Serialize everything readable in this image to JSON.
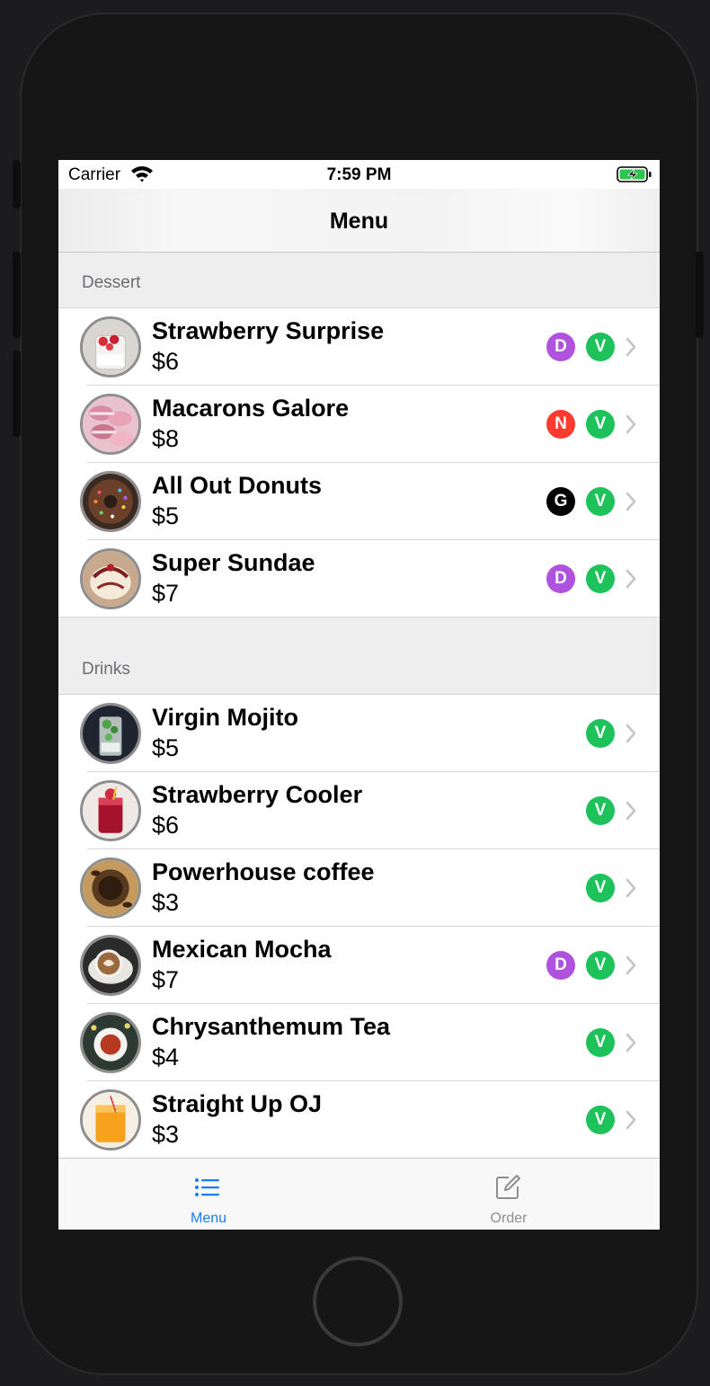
{
  "status_bar": {
    "carrier": "Carrier",
    "time": "7:59 PM"
  },
  "nav": {
    "title": "Menu"
  },
  "sections": [
    {
      "title": "Dessert",
      "items": [
        {
          "name": "Strawberry Surprise",
          "price": "$6",
          "badges": [
            {
              "letter": "D",
              "color": "#af52de"
            },
            {
              "letter": "V",
              "color": "#1ec25a"
            }
          ],
          "image": "strawberry-dessert"
        },
        {
          "name": "Macarons Galore",
          "price": "$8",
          "badges": [
            {
              "letter": "N",
              "color": "#ff3b30"
            },
            {
              "letter": "V",
              "color": "#1ec25a"
            }
          ],
          "image": "macarons"
        },
        {
          "name": "All Out Donuts",
          "price": "$5",
          "badges": [
            {
              "letter": "G",
              "color": "#000000"
            },
            {
              "letter": "V",
              "color": "#1ec25a"
            }
          ],
          "image": "donuts"
        },
        {
          "name": "Super Sundae",
          "price": "$7",
          "badges": [
            {
              "letter": "D",
              "color": "#af52de"
            },
            {
              "letter": "V",
              "color": "#1ec25a"
            }
          ],
          "image": "sundae"
        }
      ]
    },
    {
      "title": "Drinks",
      "items": [
        {
          "name": "Virgin Mojito",
          "price": "$5",
          "badges": [
            {
              "letter": "V",
              "color": "#1ec25a"
            }
          ],
          "image": "mojito"
        },
        {
          "name": "Strawberry Cooler",
          "price": "$6",
          "badges": [
            {
              "letter": "V",
              "color": "#1ec25a"
            }
          ],
          "image": "strawberry-cooler"
        },
        {
          "name": "Powerhouse coffee",
          "price": "$3",
          "badges": [
            {
              "letter": "V",
              "color": "#1ec25a"
            }
          ],
          "image": "coffee-beans"
        },
        {
          "name": "Mexican Mocha",
          "price": "$7",
          "badges": [
            {
              "letter": "D",
              "color": "#af52de"
            },
            {
              "letter": "V",
              "color": "#1ec25a"
            }
          ],
          "image": "mocha"
        },
        {
          "name": "Chrysanthemum Tea",
          "price": "$4",
          "badges": [
            {
              "letter": "V",
              "color": "#1ec25a"
            }
          ],
          "image": "tea"
        },
        {
          "name": "Straight Up OJ",
          "price": "$3",
          "badges": [
            {
              "letter": "V",
              "color": "#1ec25a"
            }
          ],
          "image": "orange-juice"
        }
      ]
    }
  ],
  "tabs": [
    {
      "label": "Menu",
      "icon": "list-icon",
      "active": true
    },
    {
      "label": "Order",
      "icon": "compose-icon",
      "active": false
    }
  ],
  "colors": {
    "accent": "#1a7cf5",
    "inactive": "#8e8e93"
  }
}
